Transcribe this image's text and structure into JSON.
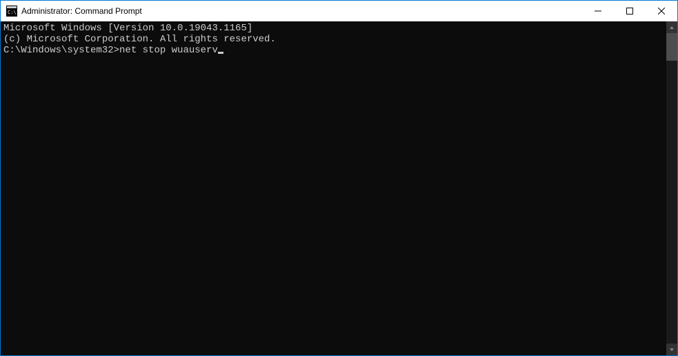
{
  "window": {
    "title": "Administrator: Command Prompt"
  },
  "terminal": {
    "line1": "Microsoft Windows [Version 10.0.19043.1165]",
    "line2": "(c) Microsoft Corporation. All rights reserved.",
    "blank": "",
    "prompt": "C:\\Windows\\system32>",
    "command": "net stop wuauserv"
  }
}
